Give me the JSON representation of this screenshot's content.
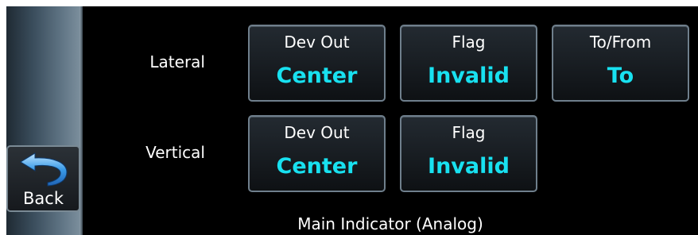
{
  "sidebar": {
    "back_label": "Back",
    "back_icon": "back-arrow-icon"
  },
  "rows": [
    {
      "label": "Lateral",
      "tiles": [
        {
          "title": "Dev Out",
          "value": "Center"
        },
        {
          "title": "Flag",
          "value": "Invalid"
        },
        {
          "title": "To/From",
          "value": "To"
        }
      ]
    },
    {
      "label": "Vertical",
      "tiles": [
        {
          "title": "Dev Out",
          "value": "Center"
        },
        {
          "title": "Flag",
          "value": "Invalid"
        }
      ]
    }
  ],
  "footer": {
    "title": "Main Indicator (Analog)"
  },
  "colors": {
    "background": "#000000",
    "value_accent": "#18e1f0",
    "label_text": "#ffffff",
    "tile_border": "#6f7f8c"
  }
}
